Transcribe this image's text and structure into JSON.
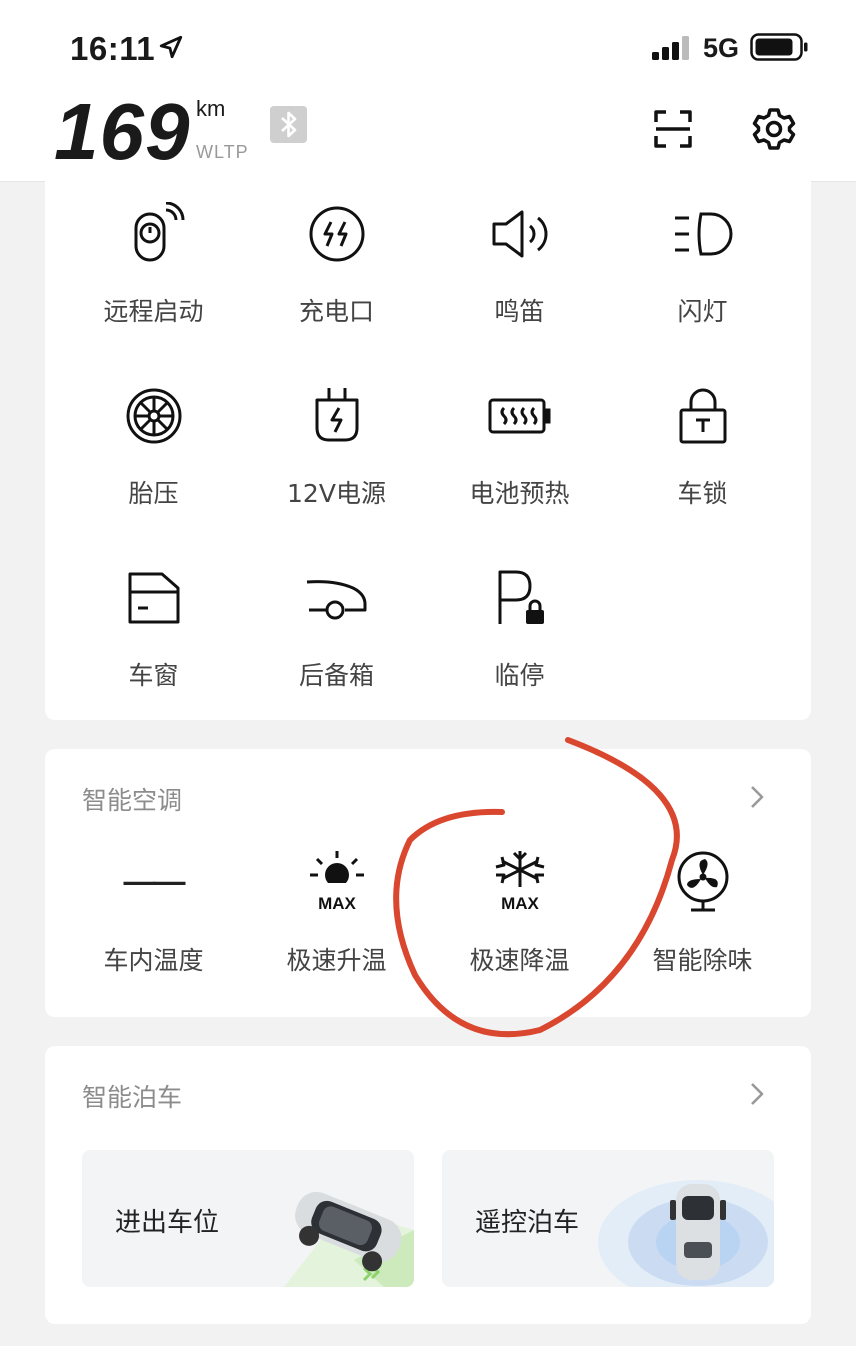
{
  "status_bar": {
    "time": "16:11",
    "network": "5G"
  },
  "header": {
    "range_value": "169",
    "range_unit": "km",
    "range_standard": "WLTP"
  },
  "controls": [
    {
      "label": "远程启动",
      "icon": "remote-start-icon"
    },
    {
      "label": "充电口",
      "icon": "charge-port-icon"
    },
    {
      "label": "鸣笛",
      "icon": "horn-icon"
    },
    {
      "label": "闪灯",
      "icon": "headlight-flash-icon"
    },
    {
      "label": "胎压",
      "icon": "tire-pressure-icon"
    },
    {
      "label": "12V电源",
      "icon": "power-12v-icon"
    },
    {
      "label": "电池预热",
      "icon": "battery-preheat-icon"
    },
    {
      "label": "车锁",
      "icon": "car-lock-icon"
    },
    {
      "label": "车窗",
      "icon": "car-window-icon"
    },
    {
      "label": "后备箱",
      "icon": "trunk-icon"
    },
    {
      "label": "临停",
      "icon": "temporary-parking-icon"
    }
  ],
  "climate": {
    "title": "智能空调",
    "items": [
      {
        "label": "车内温度",
        "icon": "cabin-temperature-icon",
        "value": "——"
      },
      {
        "label": "极速升温",
        "icon": "max-heat-icon",
        "badge": "MAX"
      },
      {
        "label": "极速降温",
        "icon": "max-cool-icon",
        "badge": "MAX"
      },
      {
        "label": "智能除味",
        "icon": "odor-removal-fan-icon"
      }
    ]
  },
  "parking": {
    "title": "智能泊车",
    "items": [
      {
        "label": "进出车位",
        "icon": "park-in-out-car-image"
      },
      {
        "label": "遥控泊车",
        "icon": "remote-parking-car-image"
      }
    ]
  },
  "colors": {
    "annotation": "#d9472f",
    "accent_green": "#8bd36a",
    "accent_blue": "#b9d3f2"
  }
}
